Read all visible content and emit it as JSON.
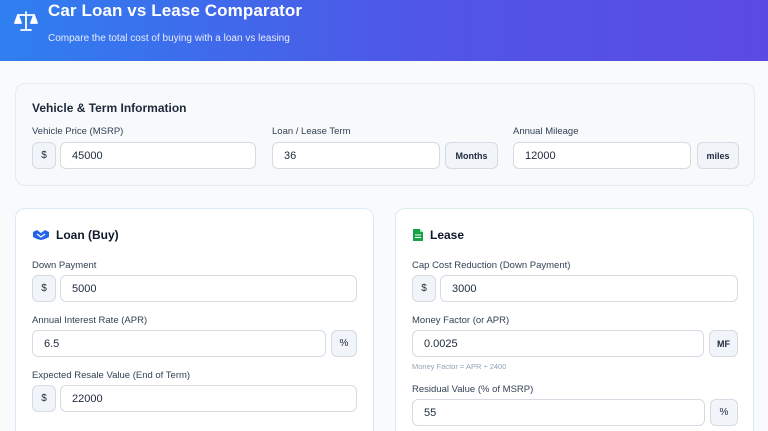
{
  "header": {
    "title": "Car Loan vs Lease Comparator",
    "subtitle": "Compare the total cost of buying with a loan vs leasing"
  },
  "vehicle": {
    "section_title": "Vehicle & Term Information",
    "price": {
      "label": "Vehicle Price (MSRP)",
      "prefix": "$",
      "value": "45000"
    },
    "term": {
      "label": "Loan / Lease Term",
      "value": "36",
      "suffix": "Months"
    },
    "mileage": {
      "label": "Annual Mileage",
      "value": "12000",
      "suffix": "miles"
    }
  },
  "loan": {
    "title": "Loan (Buy)",
    "down_payment": {
      "label": "Down Payment",
      "prefix": "$",
      "value": "5000"
    },
    "apr": {
      "label": "Annual Interest Rate (APR)",
      "value": "6.5",
      "suffix": "%"
    },
    "resale": {
      "label": "Expected Resale Value (End of Term)",
      "prefix": "$",
      "value": "22000"
    }
  },
  "lease": {
    "title": "Lease",
    "cap_cost": {
      "label": "Cap Cost Reduction (Down Payment)",
      "prefix": "$",
      "value": "3000"
    },
    "money_factor": {
      "label": "Money Factor (or APR)",
      "value": "0.0025",
      "suffix": "MF",
      "hint": "Money Factor = APR ÷ 2400"
    },
    "residual": {
      "label": "Residual Value (% of MSRP)",
      "value": "55",
      "suffix": "%"
    }
  },
  "icons": {
    "logo": "scale-icon",
    "loan": "handshake-icon",
    "lease": "document-icon"
  },
  "colors": {
    "header_start": "#2f7ff0",
    "header_end": "#5b4be3",
    "loan_icon": "#2563eb",
    "lease_icon": "#16a34a"
  }
}
